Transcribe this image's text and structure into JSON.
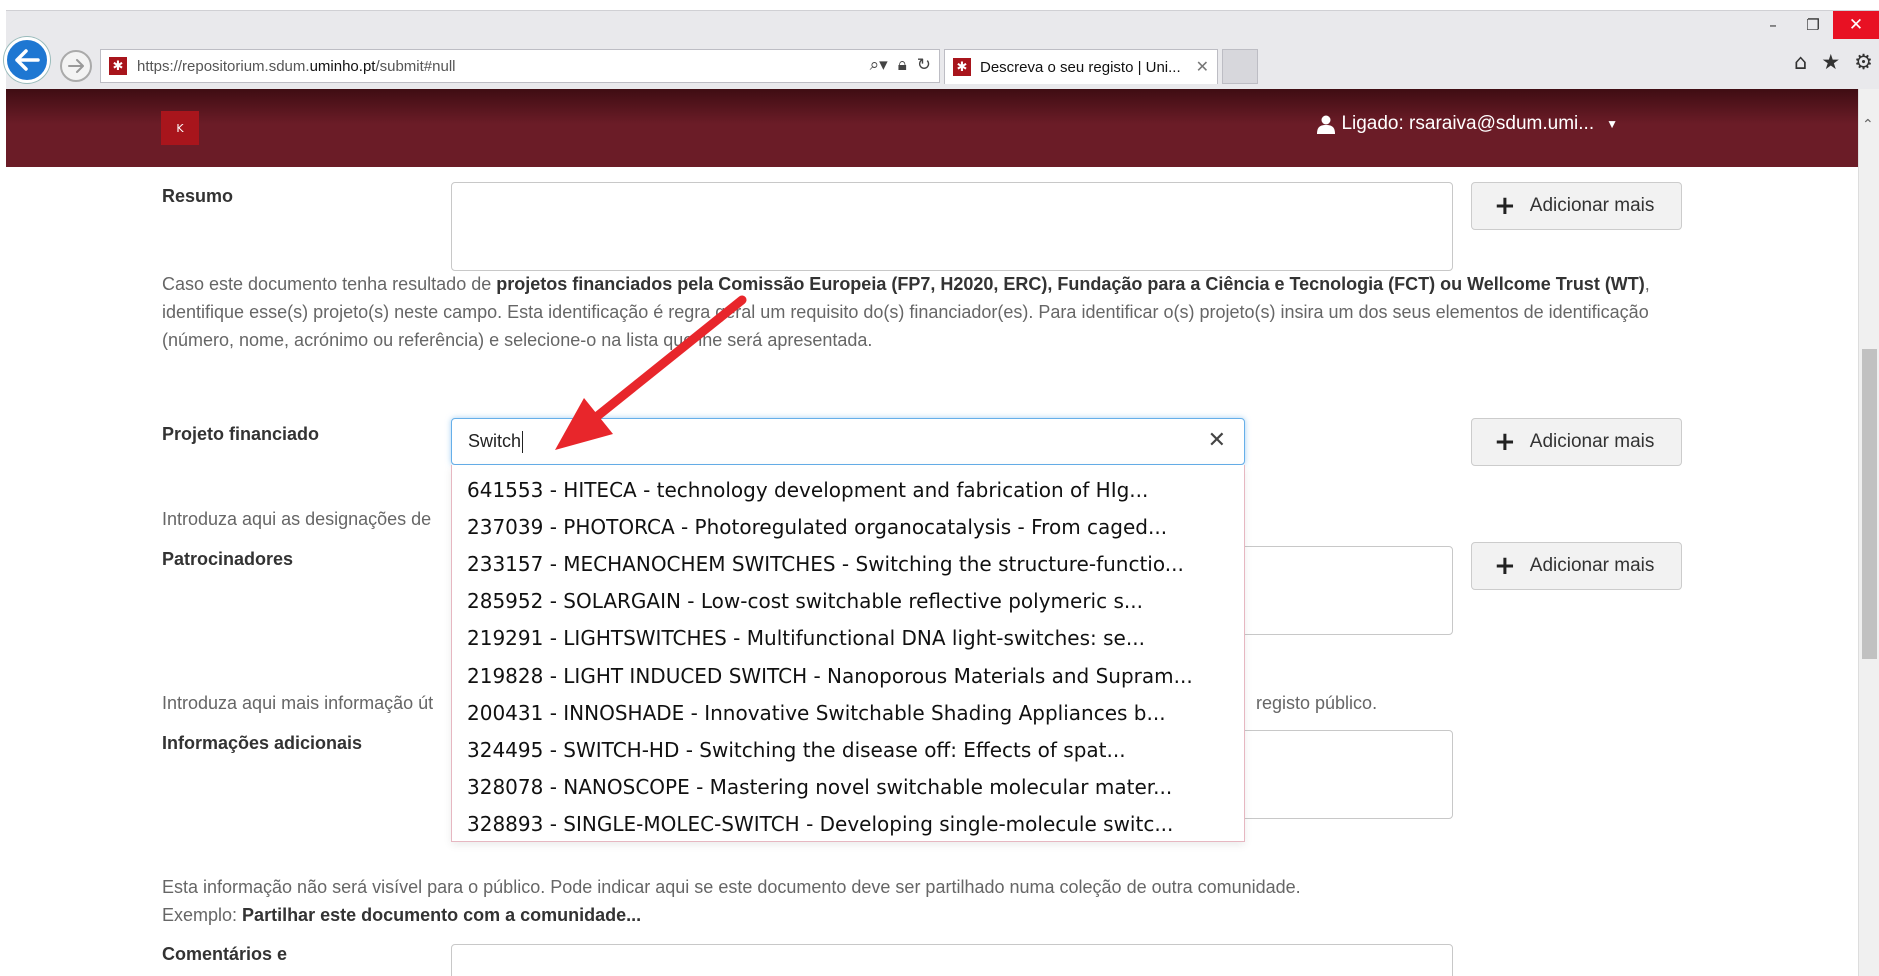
{
  "browser": {
    "url_prefix": "https://repositorium.sdum.",
    "url_domain": "uminho.pt",
    "url_suffix": "/submit#null",
    "tab_title": "Descreva o seu registo | Uni...",
    "controls": {
      "minimize": "–",
      "restore": "❐",
      "close": "✕"
    }
  },
  "header": {
    "logo_text": "K",
    "user_label": "Ligado: rsaraiva@sdum.umi..."
  },
  "form": {
    "resumo_label": "Resumo",
    "add_more": "Adicionar mais",
    "projeto_help_plain1": "Caso este documento tenha resultado de ",
    "projeto_help_bold1": "projetos financiados pela Comissão Europeia (FP7, H2020, ERC), Fundação para a Ciência e Tecnologia (FCT) ou Wellcome Trust (WT)",
    "projeto_help_plain2": ", identifique esse(s) projeto(s) neste campo. Esta identificação é regra geral um requisito do(s) financiador(es). Para identificar o(s) projeto(s) insira um dos seus elementos de identificação (número, nome, acrónimo ou referência) e selecione-o na lista que lhe será apresentada.",
    "projeto_label": "Projeto financiado",
    "projeto_value": "Switch",
    "patroc_help": "Introduza aqui as designações de",
    "patroc_label": "Patrocinadores",
    "info_help_left": "Introduza aqui mais informação út",
    "info_help_right": "registo público.",
    "info_label": "Informações adicionais",
    "coment_help": "Esta informação não será visível para o público. Pode indicar aqui se este documento deve ser partilhado numa coleção de outra comunidade.",
    "coment_example_plain": "Exemplo: ",
    "coment_example_bold": "Partilhar este documento com a comunidade...",
    "coment_label": "Comentários e"
  },
  "suggestions": [
    "641553 - HITECA - technology development and fabrication of HIg...",
    "237039 - PHOTORCA - Photoregulated organocatalysis - From caged...",
    "233157 - MECHANOCHEM SWITCHES - Switching the structure-functio...",
    "285952 - SOLARGAIN - Low-cost switchable reflective polymeric s...",
    "219291 - LIGHTSWITCHES - Multifunctional DNA light-switches: se...",
    "219828 - LIGHT INDUCED SWITCH - Nanoporous Materials and Supram...",
    "200431 - INNOSHADE - Innovative Switchable Shading Appliances b...",
    "324495 - SWITCH-HD - Switching the disease off: Effects of spat...",
    "328078 - NANOSCOPE - Mastering novel switchable molecular mater...",
    "328893 - SINGLE-MOLEC-SWITCH - Developing single-molecule switc..."
  ],
  "colors": {
    "header": "#6b1c27",
    "arrow": "#e8262b",
    "focus": "#66afe9"
  }
}
